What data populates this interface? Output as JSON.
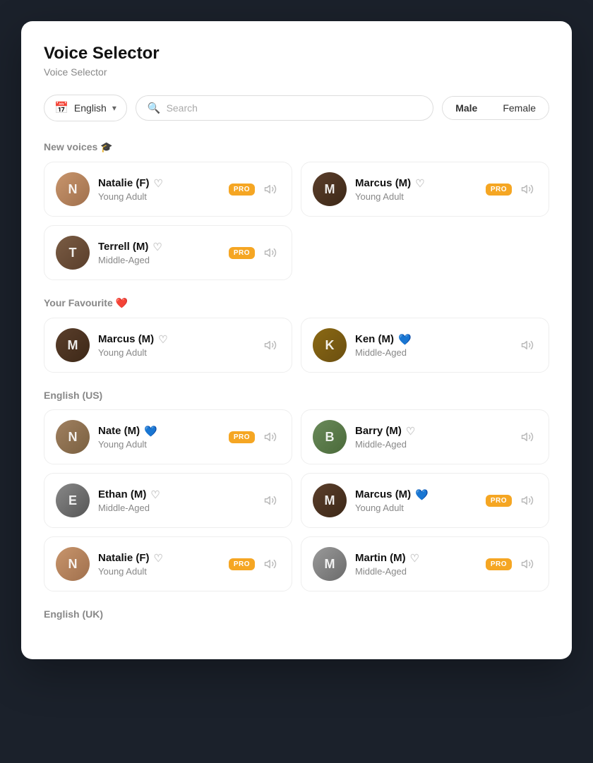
{
  "modal": {
    "title": "Voice Selector",
    "subtitle": "Voice Selector"
  },
  "filters": {
    "language_label": "English",
    "search_placeholder": "Search",
    "gender_options": [
      "Male",
      "Female"
    ],
    "active_gender": "Male"
  },
  "sections": [
    {
      "id": "new-voices",
      "label": "New voices",
      "emoji": "🎓",
      "voices": [
        {
          "id": "natalie-new",
          "name": "Natalie (F)",
          "age": "Young Adult",
          "pro": true,
          "heart": false,
          "avatar_class": "avatar-natalie",
          "initials": "N"
        },
        {
          "id": "marcus-new",
          "name": "Marcus (M)",
          "age": "Young Adult",
          "pro": true,
          "heart": false,
          "avatar_class": "avatar-marcus",
          "initials": "M"
        },
        {
          "id": "terrell",
          "name": "Terrell (M)",
          "age": "Middle-Aged",
          "pro": true,
          "heart": false,
          "avatar_class": "avatar-terrell",
          "initials": "T"
        }
      ]
    },
    {
      "id": "your-favourite",
      "label": "Your Favourite",
      "emoji": "❤️",
      "voices": [
        {
          "id": "marcus-fav",
          "name": "Marcus (M)",
          "age": "Young Adult",
          "pro": false,
          "heart": false,
          "avatar_class": "avatar-marcus",
          "initials": "M"
        },
        {
          "id": "ken-fav",
          "name": "Ken (M)",
          "age": "Middle-Aged",
          "pro": false,
          "heart": true,
          "avatar_class": "avatar-ken",
          "initials": "K"
        }
      ]
    },
    {
      "id": "english-us",
      "label": "English (US)",
      "emoji": "",
      "voices": [
        {
          "id": "nate",
          "name": "Nate (M)",
          "age": "Young Adult",
          "pro": true,
          "heart": true,
          "avatar_class": "avatar-nate",
          "initials": "N"
        },
        {
          "id": "barry",
          "name": "Barry (M)",
          "age": "Middle-Aged",
          "pro": false,
          "heart": false,
          "avatar_class": "avatar-barry",
          "initials": "B"
        },
        {
          "id": "ethan",
          "name": "Ethan (M)",
          "age": "Middle-Aged",
          "pro": false,
          "heart": false,
          "avatar_class": "avatar-ethan",
          "initials": "E"
        },
        {
          "id": "marcus-us",
          "name": "Marcus (M)",
          "age": "Young Adult",
          "pro": true,
          "heart": true,
          "avatar_class": "avatar-marcus",
          "initials": "M"
        },
        {
          "id": "natalie-us",
          "name": "Natalie (F)",
          "age": "Young Adult",
          "pro": true,
          "heart": false,
          "avatar_class": "avatar-natalie",
          "initials": "N"
        },
        {
          "id": "martin",
          "name": "Martin (M)",
          "age": "Middle-Aged",
          "pro": true,
          "heart": false,
          "avatar_class": "avatar-martin",
          "initials": "M"
        }
      ]
    },
    {
      "id": "english-uk",
      "label": "English (UK)",
      "emoji": "",
      "voices": []
    }
  ],
  "labels": {
    "pro": "PRO"
  }
}
